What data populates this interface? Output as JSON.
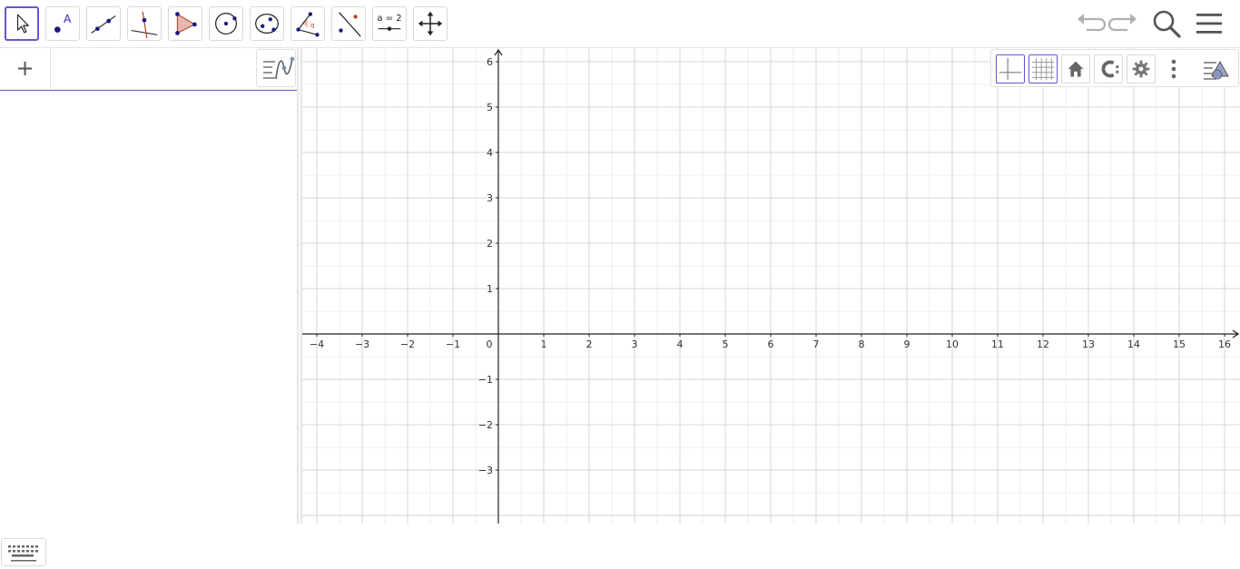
{
  "toolbar": {
    "tools": [
      {
        "id": "move",
        "label": "Move"
      },
      {
        "id": "point",
        "label": "Point",
        "glyph": "A"
      },
      {
        "id": "line",
        "label": "Line"
      },
      {
        "id": "perpendicular",
        "label": "Perpendicular Line"
      },
      {
        "id": "polygon",
        "label": "Polygon"
      },
      {
        "id": "circle",
        "label": "Circle with Center through Point"
      },
      {
        "id": "ellipse",
        "label": "Ellipse"
      },
      {
        "id": "angle",
        "label": "Angle",
        "glyph": "α"
      },
      {
        "id": "reflect",
        "label": "Reflect about Line"
      },
      {
        "id": "slider",
        "label": "Slider",
        "glyph": "a = 2"
      },
      {
        "id": "move-graphics",
        "label": "Move Graphics View"
      }
    ],
    "selected_tool": "move",
    "undo_icon": "undo-icon",
    "redo_icon": "redo-icon",
    "search_icon": "search-icon",
    "menu_icon": "menu-icon"
  },
  "algebra": {
    "add_label": "+",
    "input_value": "",
    "style_icon": "algebra-style-icon",
    "keyboard_icon": "keyboard-icon"
  },
  "graphics": {
    "x_ticks": [
      "−4",
      "−3",
      "−2",
      "−1",
      "0",
      "1",
      "2",
      "3",
      "4",
      "5",
      "6",
      "7",
      "8",
      "9",
      "10",
      "11",
      "12",
      "13",
      "14",
      "15",
      "16"
    ],
    "y_ticks_positive": [
      "1",
      "2",
      "3",
      "4",
      "5",
      "6"
    ],
    "y_ticks_negative": [
      "−1",
      "−2",
      "−3"
    ],
    "style_bar": {
      "axes_icon": "axes-icon",
      "grid_icon": "grid-icon",
      "home_icon": "home-icon",
      "label_icon": "label-icon",
      "settings_icon": "gear-icon",
      "more_icon": "more-vertical-icon",
      "view_menu_icon": "view-menu-icon"
    },
    "accent_color": "#6557d2",
    "grid_color": "#d4d4d4",
    "axis_color": "#222222"
  }
}
